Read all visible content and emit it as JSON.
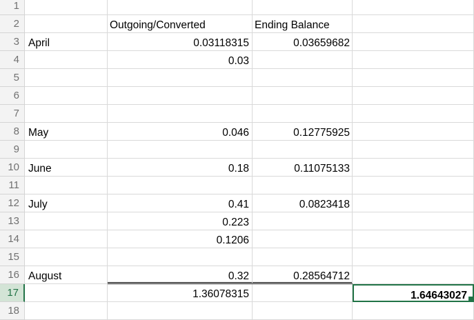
{
  "rows": [
    {
      "num": "1",
      "a": "",
      "b": "",
      "c": "",
      "d": ""
    },
    {
      "num": "2",
      "a": "",
      "b": "Outgoing/Converted",
      "c": "Ending Balance",
      "d": ""
    },
    {
      "num": "3",
      "a": "April",
      "b": "0.03118315",
      "c": "0.03659682",
      "d": ""
    },
    {
      "num": "4",
      "a": "",
      "b": "0.03",
      "c": "",
      "d": ""
    },
    {
      "num": "5",
      "a": "",
      "b": "",
      "c": "",
      "d": ""
    },
    {
      "num": "6",
      "a": "",
      "b": "",
      "c": "",
      "d": ""
    },
    {
      "num": "7",
      "a": "",
      "b": "",
      "c": "",
      "d": ""
    },
    {
      "num": "8",
      "a": "May",
      "b": "0.046",
      "c": "0.12775925",
      "d": ""
    },
    {
      "num": "9",
      "a": "",
      "b": "",
      "c": "",
      "d": ""
    },
    {
      "num": "10",
      "a": "June",
      "b": "0.18",
      "c": "0.11075133",
      "d": ""
    },
    {
      "num": "11",
      "a": "",
      "b": "",
      "c": "",
      "d": ""
    },
    {
      "num": "12",
      "a": "July",
      "b": "0.41",
      "c": "0.0823418",
      "d": ""
    },
    {
      "num": "13",
      "a": "",
      "b": "0.223",
      "c": "",
      "d": ""
    },
    {
      "num": "14",
      "a": "",
      "b": "0.1206",
      "c": "",
      "d": ""
    },
    {
      "num": "15",
      "a": "",
      "b": "",
      "c": "",
      "d": ""
    },
    {
      "num": "16",
      "a": "August",
      "b": "0.32",
      "c": "0.28564712",
      "d": ""
    },
    {
      "num": "17",
      "a": "",
      "b": "1.36078315",
      "c": "",
      "d": "1.64643027"
    },
    {
      "num": "18",
      "a": "",
      "b": "",
      "c": "",
      "d": ""
    }
  ],
  "colors": {
    "accent": "#217346",
    "gridline": "#d9d9d9",
    "header_bg": "#f3f3f3"
  }
}
